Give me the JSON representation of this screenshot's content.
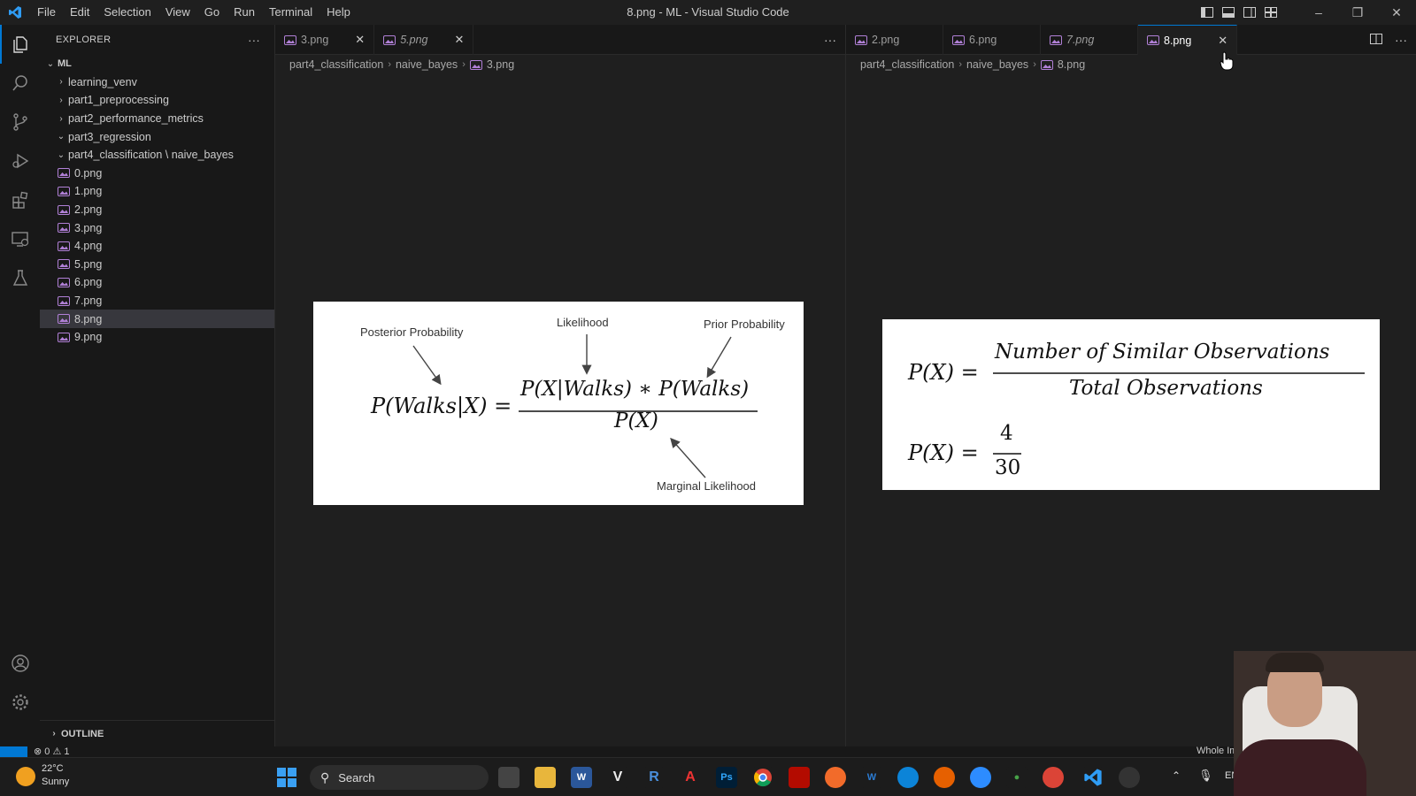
{
  "titlebar": {
    "menu": [
      "File",
      "Edit",
      "Selection",
      "View",
      "Go",
      "Run",
      "Terminal",
      "Help"
    ],
    "title": "8.png - ML - Visual Studio Code"
  },
  "sidebar": {
    "header": "EXPLORER",
    "more": "···",
    "root": "ML",
    "items": [
      {
        "label": "learning_venv",
        "type": "folder",
        "expanded": false
      },
      {
        "label": "part1_preprocessing",
        "type": "folder",
        "expanded": false
      },
      {
        "label": "part2_performance_metrics",
        "type": "folder",
        "expanded": false
      },
      {
        "label": "part3_regression",
        "type": "folder",
        "expanded": true
      },
      {
        "label": "part4_classification \\ naive_bayes",
        "type": "folder",
        "expanded": true
      },
      {
        "label": "0.png",
        "type": "file"
      },
      {
        "label": "1.png",
        "type": "file"
      },
      {
        "label": "2.png",
        "type": "file"
      },
      {
        "label": "3.png",
        "type": "file"
      },
      {
        "label": "4.png",
        "type": "file"
      },
      {
        "label": "5.png",
        "type": "file"
      },
      {
        "label": "6.png",
        "type": "file"
      },
      {
        "label": "7.png",
        "type": "file"
      },
      {
        "label": "8.png",
        "type": "file",
        "selected": true
      },
      {
        "label": "9.png",
        "type": "file"
      }
    ],
    "outline": "OUTLINE"
  },
  "left_group": {
    "tabs": [
      {
        "label": "3.png",
        "active": false,
        "italic": false
      },
      {
        "label": "5.png",
        "active": false,
        "italic": true
      }
    ],
    "more": "···",
    "breadcrumb": [
      "part4_classification",
      "naive_bayes",
      "3.png"
    ],
    "image": {
      "posterior": "Posterior Probability",
      "likelihood": "Likelihood",
      "prior": "Prior Probability",
      "marginal": "Marginal Likelihood",
      "lhs": "P(Walks|X) =",
      "numerator": "P(X|Walks) ∗ P(Walks)",
      "denominator": "P(X)"
    }
  },
  "right_group": {
    "tabs": [
      {
        "label": "2.png",
        "active": false,
        "italic": false
      },
      {
        "label": "6.png",
        "active": false,
        "italic": false
      },
      {
        "label": "7.png",
        "active": false,
        "italic": true
      },
      {
        "label": "8.png",
        "active": true,
        "italic": false
      }
    ],
    "breadcrumb": [
      "part4_classification",
      "naive_bayes",
      "8.png"
    ],
    "image": {
      "lhs1": "P(X) =",
      "num1": "Number of Similar Observations",
      "den1": "Total Observations",
      "lhs2": "P(X) =",
      "num2": "4",
      "den2": "30"
    }
  },
  "statusbar": {
    "errors": "0",
    "warnings": "1",
    "right_text": "Whole Image"
  },
  "taskbar": {
    "weather_temp": "22°C",
    "weather_desc": "Sunny",
    "search_placeholder": "Search",
    "lang": "ENG"
  },
  "colors": {
    "accent": "#0078d4",
    "image_icon": "#b180d7"
  }
}
